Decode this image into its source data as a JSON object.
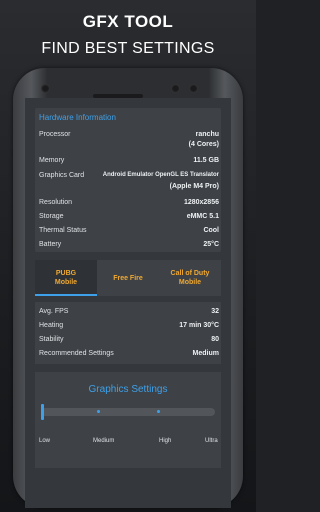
{
  "header": {
    "title_gfx": "GFX",
    "title_tool": "TOOL",
    "subtitle": "FIND BEST SETTINGS"
  },
  "hardware": {
    "title": "Hardware Information",
    "rows": [
      {
        "k": "Processor",
        "v1": "ranchu",
        "v2": "(4 Cores)"
      },
      {
        "k": "Memory",
        "v1": "11.5 GB"
      },
      {
        "k": "Graphics Card",
        "v1": "Android Emulator OpenGL ES Translator",
        "v2": "(Apple M4 Pro)"
      },
      {
        "k": "Resolution",
        "v1": "1280x2856"
      },
      {
        "k": "Storage",
        "v1": "eMMC 5.1"
      },
      {
        "k": "Thermal Status",
        "v1": "Cool"
      },
      {
        "k": "Battery",
        "v1": "25°C"
      }
    ]
  },
  "tabs": [
    {
      "l1": "PUBG",
      "l2": "Mobile"
    },
    {
      "l1": "Free Fire"
    },
    {
      "l1": "Call of Duty",
      "l2": "Mobile"
    }
  ],
  "stats": [
    {
      "k": "Avg. FPS",
      "v": "32"
    },
    {
      "k": "Heating",
      "v": "17 min 30°C"
    },
    {
      "k": "Stability",
      "v": "80"
    },
    {
      "k": "Recommended Settings",
      "v": "Medium"
    }
  ],
  "graphics": {
    "title": "Graphics Settings",
    "levels": [
      "Low",
      "Medium",
      "High",
      "Ultra"
    ],
    "level_fraction": 0
  },
  "colors": {
    "accent": "#3ea0e8",
    "tab_text": "#f0a830"
  }
}
